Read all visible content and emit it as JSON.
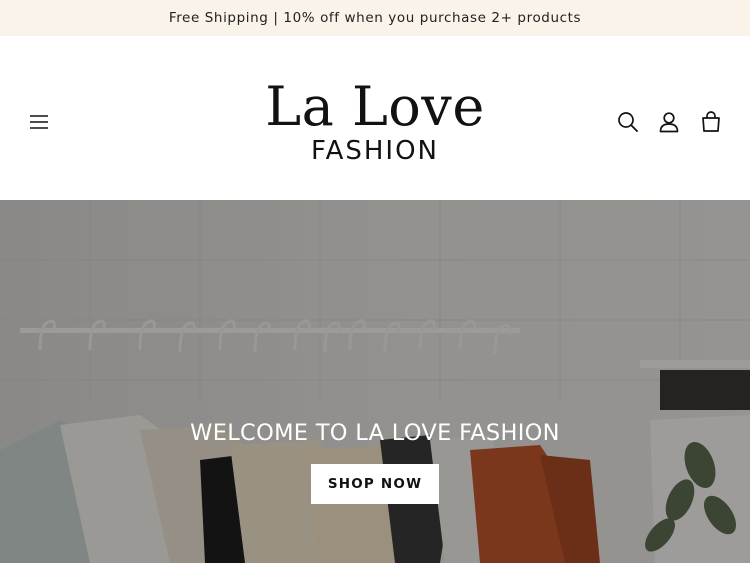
{
  "announcement": {
    "text": "Free Shipping | 10% off when you purchase 2+ products"
  },
  "header": {
    "menu_icon": "hamburger-menu-icon",
    "logo": {
      "line1": "La Love",
      "line2": "FASHION"
    },
    "icons": [
      "search-icon",
      "account-icon",
      "cart-icon"
    ]
  },
  "hero": {
    "title": "WELCOME TO LA LOVE FASHION",
    "button_label": "SHOP NOW",
    "image_subject": "clothing-rack-photo"
  },
  "colors": {
    "announcement_bg": "#faf3e9",
    "text_dark": "#121212",
    "hero_overlay": "#000000"
  }
}
